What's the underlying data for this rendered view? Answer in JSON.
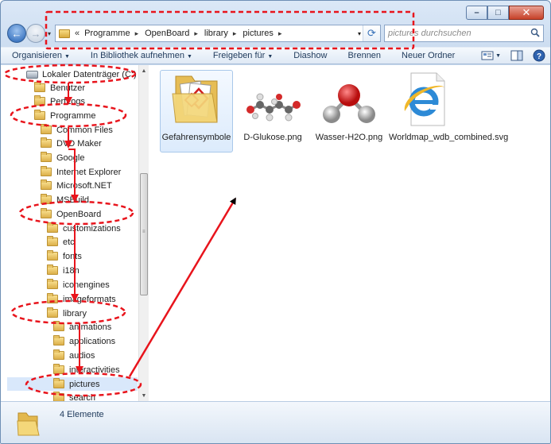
{
  "window": {
    "caption": {
      "minimize": "–",
      "maximize": "□",
      "close": "✕"
    }
  },
  "nav": {
    "back": "←",
    "forward": "→",
    "recent": "▾"
  },
  "address": {
    "prefix": "«",
    "crumbs": [
      "Programme",
      "OpenBoard",
      "library",
      "pictures"
    ],
    "separator": "▸",
    "dropdown": "▾",
    "refresh": "⟳"
  },
  "search": {
    "placeholder": "pictures durchsuchen"
  },
  "toolbar": {
    "items": [
      {
        "label": "Organisieren",
        "dropdown": "▼"
      },
      {
        "label": "In Bibliothek aufnehmen",
        "dropdown": "▼"
      },
      {
        "label": "Freigeben für",
        "dropdown": "▼"
      },
      {
        "label": "Diashow"
      },
      {
        "label": "Brennen"
      },
      {
        "label": "Neuer Ordner"
      }
    ],
    "view_dropdown": "▼"
  },
  "tree": {
    "items": [
      {
        "label": "Lokaler Datenträger (C:)",
        "kind": "drive"
      },
      {
        "label": "Benutzer",
        "kind": "folder"
      },
      {
        "label": "PerfLogs",
        "kind": "folder"
      },
      {
        "label": "Programme",
        "kind": "folder"
      },
      {
        "label": "Common Files",
        "kind": "folder"
      },
      {
        "label": "DVD Maker",
        "kind": "folder"
      },
      {
        "label": "Google",
        "kind": "folder"
      },
      {
        "label": "Internet Explorer",
        "kind": "folder"
      },
      {
        "label": "Microsoft.NET",
        "kind": "folder"
      },
      {
        "label": "MSBuild",
        "kind": "folder"
      },
      {
        "label": "OpenBoard",
        "kind": "folder"
      },
      {
        "label": "customizations",
        "kind": "folder"
      },
      {
        "label": "etc",
        "kind": "folder"
      },
      {
        "label": "fonts",
        "kind": "folder"
      },
      {
        "label": "i18n",
        "kind": "folder"
      },
      {
        "label": "iconengines",
        "kind": "folder"
      },
      {
        "label": "imageformats",
        "kind": "folder"
      },
      {
        "label": "library",
        "kind": "folder"
      },
      {
        "label": "animations",
        "kind": "folder"
      },
      {
        "label": "applications",
        "kind": "folder"
      },
      {
        "label": "audios",
        "kind": "folder"
      },
      {
        "label": "interactivities",
        "kind": "folder"
      },
      {
        "label": "pictures",
        "kind": "folder"
      },
      {
        "label": "search",
        "kind": "folder"
      }
    ],
    "scroll_up": "▲",
    "scroll_down": "▼",
    "grip": "≡"
  },
  "files": [
    {
      "label": "Gefahrensymbole",
      "kind": "folder"
    },
    {
      "label": "D-Glukose.png",
      "kind": "molecule"
    },
    {
      "label": "Wasser-H2O.png",
      "kind": "water"
    },
    {
      "label": "Worldmap_wdb_combined.svg",
      "kind": "ie"
    }
  ],
  "status": {
    "count_text": "4 Elemente"
  },
  "colors": {
    "annotation_red": "#e8141c",
    "selection_blue": "#d9e8fb",
    "window_frame": "#6e8fb5"
  }
}
